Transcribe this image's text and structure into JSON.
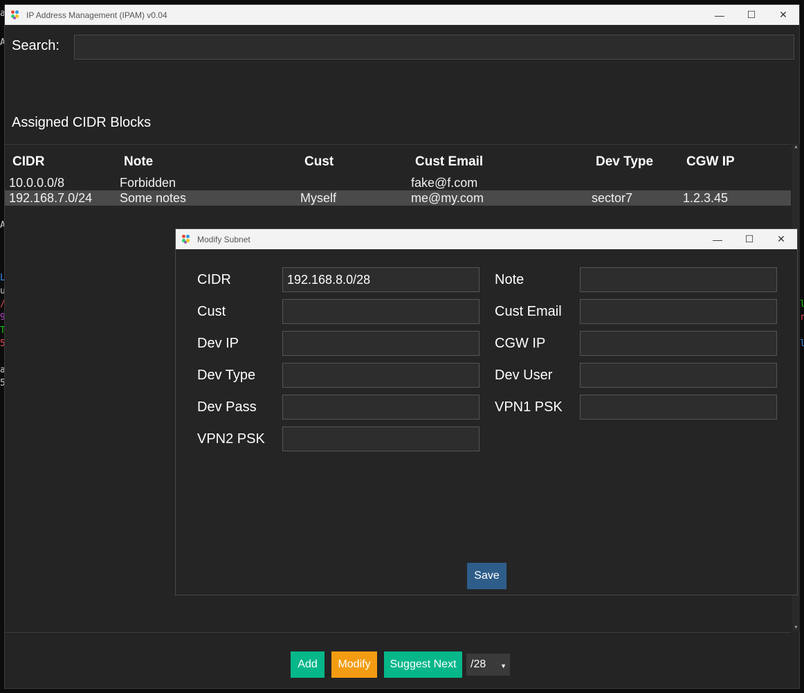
{
  "main_window": {
    "title": "IP Address Management (IPAM) v0.04",
    "controls": {
      "minimize": "—",
      "maximize": "☐",
      "close": "✕"
    }
  },
  "search": {
    "label": "Search:",
    "value": ""
  },
  "section_title": "Assigned CIDR Blocks",
  "table": {
    "headers": [
      "CIDR",
      "Note",
      "Cust",
      "Cust Email",
      "Dev Type",
      "CGW IP"
    ],
    "rows": [
      {
        "cidr": "10.0.0.0/8",
        "note": "Forbidden",
        "cust": "",
        "cust_email": "fake@f.com",
        "dev_type": "",
        "cgw_ip": ""
      },
      {
        "cidr": "192.168.7.0/24",
        "note": "Some notes",
        "cust": "Myself",
        "cust_email": "me@my.com",
        "dev_type": "sector7",
        "cgw_ip": "1.2.3.45"
      }
    ]
  },
  "buttons": {
    "add": "Add",
    "modify": "Modify",
    "suggest_next": "Suggest Next"
  },
  "prefix_select": {
    "value": "/28"
  },
  "dialog": {
    "title": "Modify Subnet",
    "controls": {
      "minimize": "—",
      "maximize": "☐",
      "close": "✕"
    },
    "fields": {
      "cidr": {
        "label": "CIDR",
        "value": "192.168.8.0/28"
      },
      "note": {
        "label": "Note",
        "value": ""
      },
      "cust": {
        "label": "Cust",
        "value": ""
      },
      "cust_email": {
        "label": "Cust Email",
        "value": ""
      },
      "dev_ip": {
        "label": "Dev IP",
        "value": ""
      },
      "cgw_ip": {
        "label": "CGW IP",
        "value": ""
      },
      "dev_type": {
        "label": "Dev Type",
        "value": ""
      },
      "dev_user": {
        "label": "Dev User",
        "value": ""
      },
      "dev_pass": {
        "label": "Dev Pass",
        "value": ""
      },
      "vpn1_psk": {
        "label": "VPN1 PSK",
        "value": ""
      },
      "vpn2_psk": {
        "label": "VPN2 PSK",
        "value": ""
      }
    },
    "save_label": "Save"
  },
  "background_terminal": {
    "left_chars": [
      "a",
      "A",
      "A",
      "L",
      "u",
      "/",
      "9",
      "T",
      "5",
      "a",
      "5"
    ],
    "right_chars": [
      "l",
      "r",
      "l"
    ]
  },
  "colors": {
    "accent_green": "#06b78a",
    "accent_orange": "#f39c12",
    "save_blue": "#2f5d8a"
  }
}
